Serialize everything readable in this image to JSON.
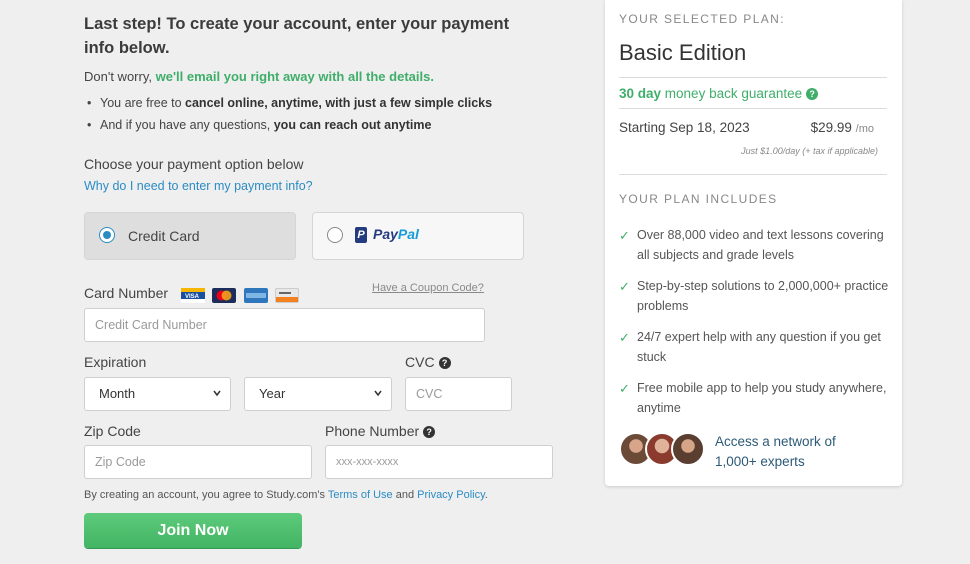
{
  "header": {
    "title": "Last step! To create your account, enter your payment info below.",
    "worry_prefix": "Don't worry,",
    "worry_highlight": "we'll email you right away with all the details."
  },
  "bullets": [
    {
      "prefix": "You are free to ",
      "bold": "cancel online, anytime, with just a few simple clicks"
    },
    {
      "prefix": "And if you have any questions, ",
      "bold": "you can reach out anytime"
    }
  ],
  "payment": {
    "choose_label": "Choose your payment option below",
    "why_link": "Why do I need to enter my payment info?",
    "credit_card_label": "Credit Card",
    "paypal_pay": "Pay",
    "paypal_pal": "Pal"
  },
  "form": {
    "card_number_label": "Card Number",
    "coupon_link": "Have a Coupon Code?",
    "card_number_placeholder": "Credit Card Number",
    "expiration_label": "Expiration",
    "month_value": "Month",
    "year_value": "Year",
    "cvc_label": "CVC",
    "cvc_placeholder": "CVC",
    "zip_label": "Zip Code",
    "zip_placeholder": "Zip Code",
    "phone_label": "Phone Number",
    "phone_placeholder": "xxx-xxx-xxxx"
  },
  "card_logos": [
    "visa",
    "mastercard",
    "amex",
    "discover"
  ],
  "terms": {
    "prefix": "By creating an account, you agree to Study.com's",
    "terms_link": "Terms of Use",
    "and": "and",
    "privacy_link": "Privacy Policy",
    "suffix": "."
  },
  "join_button": "Join Now",
  "plan": {
    "caption": "YOUR SELECTED PLAN:",
    "name": "Basic Edition",
    "guarantee_bold": "30 day",
    "guarantee_rest": "money back guarantee",
    "starting": "Starting Sep 18, 2023",
    "price": "$29.99",
    "price_unit": "/mo",
    "per_day": "Just $1.00/day (+ tax if applicable)",
    "includes_caption": "YOUR PLAN INCLUDES",
    "features": [
      "Over 88,000 video and text lessons covering all subjects and grade levels",
      "Step-by-step solutions to 2,000,000+ practice problems",
      "24/7 expert help with any question if you get stuck",
      "Free mobile app to help you study anywhere, anytime"
    ],
    "experts_text": "Access a network of 1,000+ experts"
  },
  "colors": {
    "accent_green": "#3fae6a",
    "link_blue": "#2b8cc4",
    "paypal_dark": "#253b80",
    "paypal_light": "#179bd7"
  },
  "icons": [
    "question-circle-icon",
    "check-icon",
    "chevron-down-icon",
    "paypal-icon",
    "visa-icon",
    "mastercard-icon",
    "amex-icon",
    "discover-icon"
  ]
}
